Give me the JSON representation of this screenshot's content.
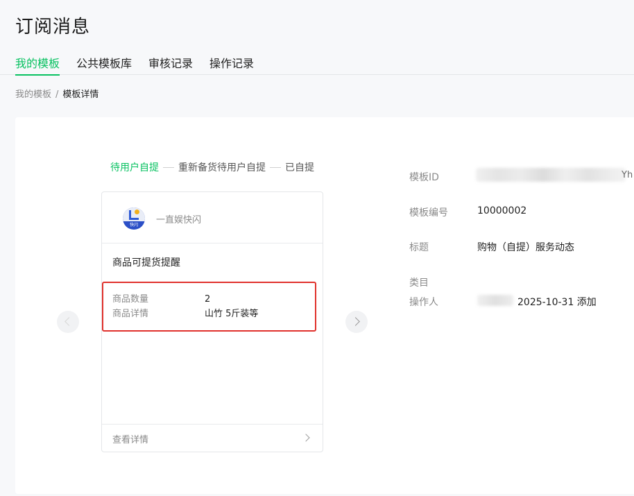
{
  "page": {
    "title": "订阅消息"
  },
  "tabs": [
    {
      "label": "我的模板",
      "active": true
    },
    {
      "label": "公共模板库",
      "active": false
    },
    {
      "label": "审核记录",
      "active": false
    },
    {
      "label": "操作记录",
      "active": false
    }
  ],
  "breadcrumb": {
    "parent": "我的模板",
    "separator": "/",
    "current": "模板详情"
  },
  "steps": [
    {
      "label": "待用户自提",
      "active": true
    },
    {
      "label": "重新备货待用户自提",
      "active": false
    },
    {
      "label": "已自提",
      "active": false
    }
  ],
  "preview": {
    "brand": "一直娱快闪",
    "avatar_text": "快闪",
    "title": "商品可提货提醒",
    "fields": [
      {
        "key": "商品数量",
        "value": "2"
      },
      {
        "key": "商品详情",
        "value": "山竹 5斤装等"
      }
    ],
    "footer_label": "查看详情"
  },
  "info": {
    "template_id_label": "模板ID",
    "template_id_tail": "Yh",
    "template_no_label": "模板编号",
    "template_no_value": "10000002",
    "title_label": "标题",
    "title_value": "购物（自提）服务动态",
    "category_label": "类目",
    "operator_label": "操作人",
    "operator_value": "2025-10-31 添加"
  },
  "colors": {
    "accent": "#07c160",
    "highlight_border": "#e0302b"
  }
}
